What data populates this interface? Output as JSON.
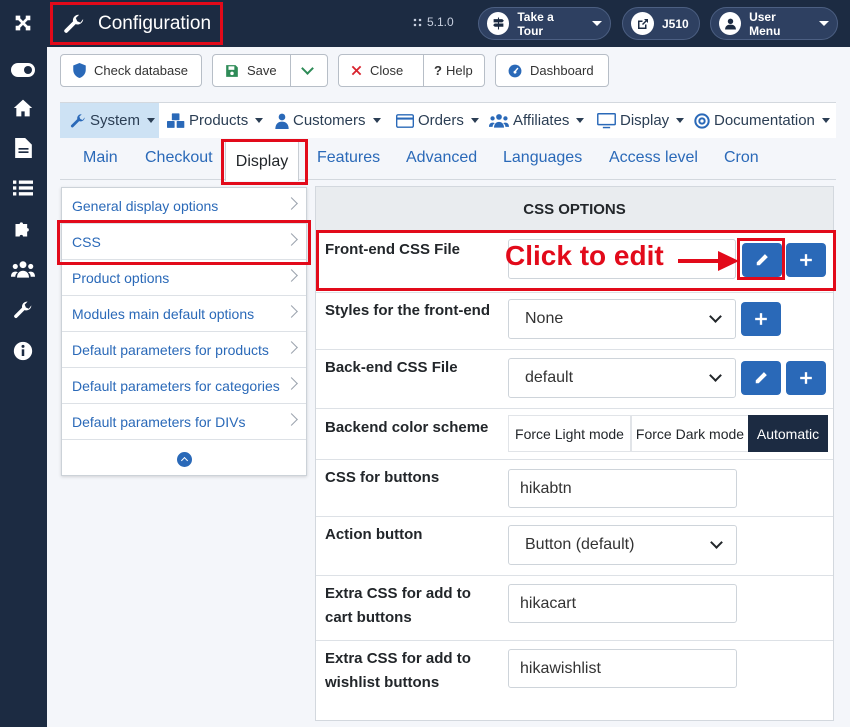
{
  "header": {
    "title": "Configuration",
    "version": "5.1.0",
    "take_tour": "Take a Tour",
    "site": "J510",
    "user_menu": "User Menu"
  },
  "toolbar": {
    "check_database": "Check database",
    "save": "Save",
    "close": "Close",
    "help": "Help",
    "dashboard": "Dashboard"
  },
  "menubar": {
    "items": [
      "System",
      "Products",
      "Customers",
      "Orders",
      "Affiliates",
      "Display",
      "Documentation"
    ]
  },
  "tabs": [
    "Main",
    "Checkout",
    "Display",
    "Features",
    "Advanced",
    "Languages",
    "Access level",
    "Cron"
  ],
  "sidemenu": {
    "items": [
      "General display options",
      "CSS",
      "Product options",
      "Modules main default options",
      "Default parameters for products",
      "Default parameters for categories",
      "Default parameters for DIVs"
    ]
  },
  "panel": {
    "title": "CSS OPTIONS",
    "frontend_css_label": "Front-end CSS File",
    "styles_label": "Styles for the front-end",
    "styles_value": "None",
    "backend_css_label": "Back-end CSS File",
    "backend_css_value": "default",
    "color_scheme_label": "Backend color scheme",
    "color_scheme_options": [
      "Force Light mode",
      "Force Dark mode",
      "Automatic"
    ],
    "css_buttons_label": "CSS for buttons",
    "css_buttons_value": "hikabtn",
    "action_button_label": "Action button",
    "action_button_value": "Button (default)",
    "extra_cart_label_1": "Extra CSS for add to",
    "extra_cart_label_2": "cart buttons",
    "extra_cart_value": "hikacart",
    "extra_wishlist_label_1": "Extra CSS for add to",
    "extra_wishlist_label_2": "wishlist buttons",
    "extra_wishlist_value": "hikawishlist"
  },
  "annotation": {
    "text": "Click to edit"
  },
  "colors": {
    "header_bg": "#1c2b42",
    "accent_blue": "#2a69b8",
    "highlight_red": "#e20a1a",
    "active_menu": "#cde2f4",
    "automatic_bg": "#1c2b42"
  }
}
